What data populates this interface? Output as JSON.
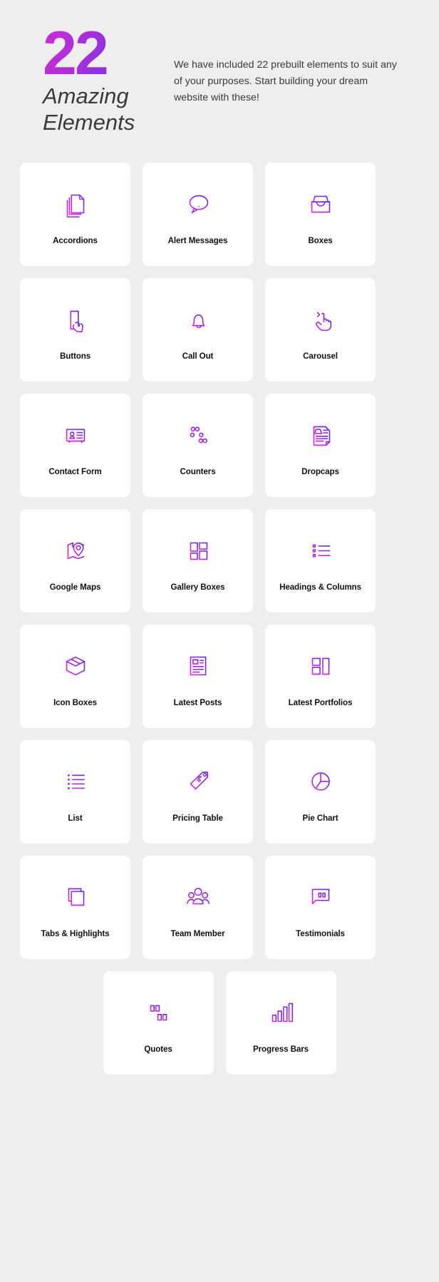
{
  "hero": {
    "number": "22",
    "subtitle_line1": "Amazing",
    "subtitle_line2": "Elements",
    "description": "We have included 22 prebuilt elements to suit any of your purposes. Start building your dream website with these!",
    "gradient_from": "#cc2bd8",
    "gradient_to": "#3f3df2"
  },
  "theme": {
    "page_background": "#eeeeee",
    "card_background": "#ffffff",
    "icon_gradient_start": "#5b2ee0",
    "icon_gradient_end": "#e52bd8",
    "label_color": "#111111"
  },
  "grid": {
    "rows": [
      {
        "cards": [
          {
            "label": "Accordions",
            "icon": "documents-stack-icon"
          },
          {
            "label": "Alert Messages",
            "icon": "speech-bubble-alert-icon"
          },
          {
            "label": "Boxes",
            "icon": "open-box-tray-icon"
          }
        ]
      },
      {
        "cards": [
          {
            "label": "Buttons",
            "icon": "phone-tap-icon"
          },
          {
            "label": "Call Out",
            "icon": "bell-icon"
          },
          {
            "label": "Carousel",
            "icon": "hand-swipe-arrow-icon"
          }
        ]
      },
      {
        "cards": [
          {
            "label": "Contact Form",
            "icon": "id-card-icon"
          },
          {
            "label": "Counters",
            "icon": "sliders-icon"
          },
          {
            "label": "Dropcaps",
            "icon": "document-letter-a-icon"
          }
        ]
      },
      {
        "cards": [
          {
            "label": "Google Maps",
            "icon": "map-pin-icon"
          },
          {
            "label": "Gallery Boxes",
            "icon": "gallery-grid-icon"
          },
          {
            "label": "Headings & Columns",
            "icon": "bullet-lines-icon"
          }
        ]
      },
      {
        "cards": [
          {
            "label": "Icon Boxes",
            "icon": "cube-box-icon"
          },
          {
            "label": "Latest Posts",
            "icon": "article-page-icon"
          },
          {
            "label": "Latest Portfolios",
            "icon": "portfolio-layout-icon"
          }
        ]
      },
      {
        "cards": [
          {
            "label": "List",
            "icon": "list-bullets-icon"
          },
          {
            "label": "Pricing Table",
            "icon": "price-tag-icon"
          },
          {
            "label": "Pie Chart",
            "icon": "pie-chart-icon"
          }
        ]
      },
      {
        "cards": [
          {
            "label": "Tabs & Highlights",
            "icon": "stacked-squares-icon"
          },
          {
            "label": "Team Member",
            "icon": "people-group-icon"
          },
          {
            "label": "Testimonials",
            "icon": "quote-bubble-icon"
          }
        ]
      },
      {
        "centered": true,
        "cards": [
          {
            "label": "Quotes",
            "icon": "quotation-marks-icon"
          },
          {
            "label": "Progress Bars",
            "icon": "bar-chart-icon"
          }
        ]
      }
    ]
  }
}
